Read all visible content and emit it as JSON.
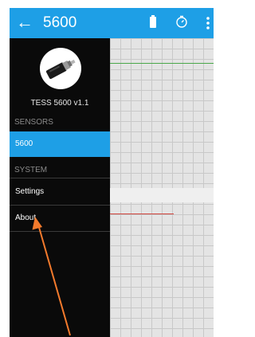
{
  "toolbar": {
    "title": "5600",
    "icons": [
      "back-arrow-icon",
      "battery-icon",
      "timer-icon",
      "overflow-menu-icon"
    ]
  },
  "drawer": {
    "device_name": "TESS 5600 v1.1",
    "sections": [
      {
        "header": "SENSORS",
        "items": [
          {
            "label": "5600",
            "active": true
          }
        ]
      },
      {
        "header": "SYSTEM",
        "items": [
          {
            "label": "Settings",
            "active": false
          },
          {
            "label": "About",
            "active": false
          }
        ]
      }
    ]
  },
  "colors": {
    "accent": "#1e9fe6",
    "drawer_bg": "#0a0a0a",
    "annotation_arrow": "#f47a2c"
  }
}
